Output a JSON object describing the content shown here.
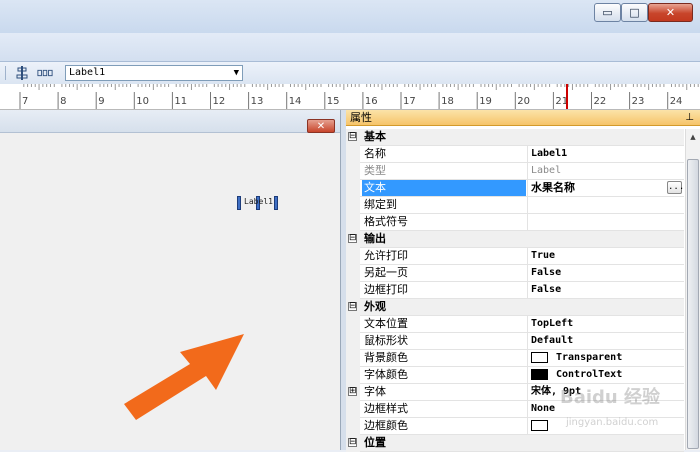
{
  "window": {
    "min_glyph": "▭",
    "max_glyph": "□",
    "close_glyph": "✕"
  },
  "toolbar": {
    "control_selector_value": "Label1",
    "dropdown_glyph": "▼"
  },
  "ruler": {
    "ticks": [
      "7",
      "8",
      "9",
      "10",
      "11",
      "12",
      "13",
      "14",
      "15",
      "16",
      "17",
      "18",
      "19",
      "20",
      "21",
      "22",
      "23",
      "24"
    ],
    "marker_color": "#cc0000"
  },
  "canvas": {
    "close_glyph": "✕",
    "label_text": "Label1",
    "arrow_color": "#f26a1b"
  },
  "properties": {
    "title": "属性",
    "pin_glyph": "⊥",
    "rows": [
      {
        "type": "cat",
        "name": "基本",
        "expander": "⊟"
      },
      {
        "type": "prop",
        "name": "名称",
        "value": "Label1"
      },
      {
        "type": "prop",
        "name": "类型",
        "value": "Label",
        "disabled": true
      },
      {
        "type": "prop",
        "name": "文本",
        "value": "水果名称",
        "selected": true,
        "button": "..."
      },
      {
        "type": "prop",
        "name": "绑定到",
        "value": ""
      },
      {
        "type": "prop",
        "name": "格式符号",
        "value": ""
      },
      {
        "type": "cat",
        "name": "输出",
        "expander": "⊟"
      },
      {
        "type": "prop",
        "name": "允许打印",
        "value": "True"
      },
      {
        "type": "prop",
        "name": "另起一页",
        "value": "False"
      },
      {
        "type": "prop",
        "name": "边框打印",
        "value": "False"
      },
      {
        "type": "cat",
        "name": "外观",
        "expander": "⊟"
      },
      {
        "type": "prop",
        "name": "文本位置",
        "value": "TopLeft"
      },
      {
        "type": "prop",
        "name": "鼠标形状",
        "value": "Default"
      },
      {
        "type": "prop",
        "name": "背景颜色",
        "value": "Transparent",
        "swatch": "#ffffff"
      },
      {
        "type": "prop",
        "name": "字体颜色",
        "value": "ControlText",
        "swatch": "#000000"
      },
      {
        "type": "prop",
        "name": "字体",
        "value": "宋体, 9pt",
        "expander": "⊞"
      },
      {
        "type": "prop",
        "name": "边框样式",
        "value": "None"
      },
      {
        "type": "prop",
        "name": "边框颜色",
        "value": "",
        "swatch": "#ffffff"
      },
      {
        "type": "cat",
        "name": "位置",
        "expander": "⊟"
      }
    ]
  },
  "watermark": {
    "text": "Baidu 经验",
    "url": "jingyan.baidu.com"
  }
}
